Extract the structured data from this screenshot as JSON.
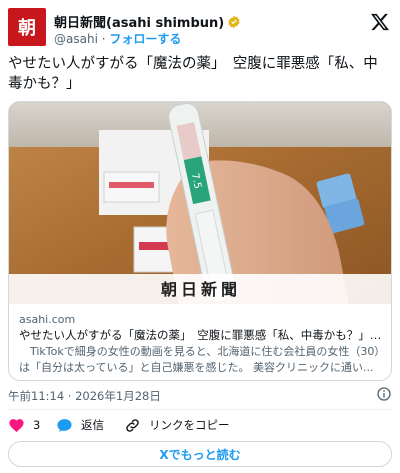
{
  "account": {
    "avatar_text": "朝",
    "display_name": "朝日新聞(asahi shimbun)",
    "handle": "@asahi",
    "separator": " · ",
    "follow_label": "フォローする"
  },
  "tweet": {
    "text": "やせたい人がすがる「魔法の薬」　空腹に罪悪感「私、中毒かも？」"
  },
  "card": {
    "image_caption": "朝日新聞",
    "pen_label": "7.5",
    "domain": "asahi.com",
    "title": "やせたい人がすがる「魔法の薬」　空腹に罪悪感「私、中毒かも？」:...",
    "description": "　TikTokで細身の女性の動画を見ると、北海道に住む会社員の女性（30）は「自分は太っている」と自己嫌悪を感じた。 美容クリニックに通い..."
  },
  "meta": {
    "timestamp": "午前11:14 · 2026年1月28日"
  },
  "actions": {
    "like_count": "3",
    "reply_label": "返信",
    "copy_link_label": "リンクをコピー"
  },
  "more_label": "Xでもっと読む",
  "colors": {
    "accent": "#1d9bf0",
    "like": "#f91880",
    "brand": "#c8161d",
    "verified": "#e2b719"
  }
}
